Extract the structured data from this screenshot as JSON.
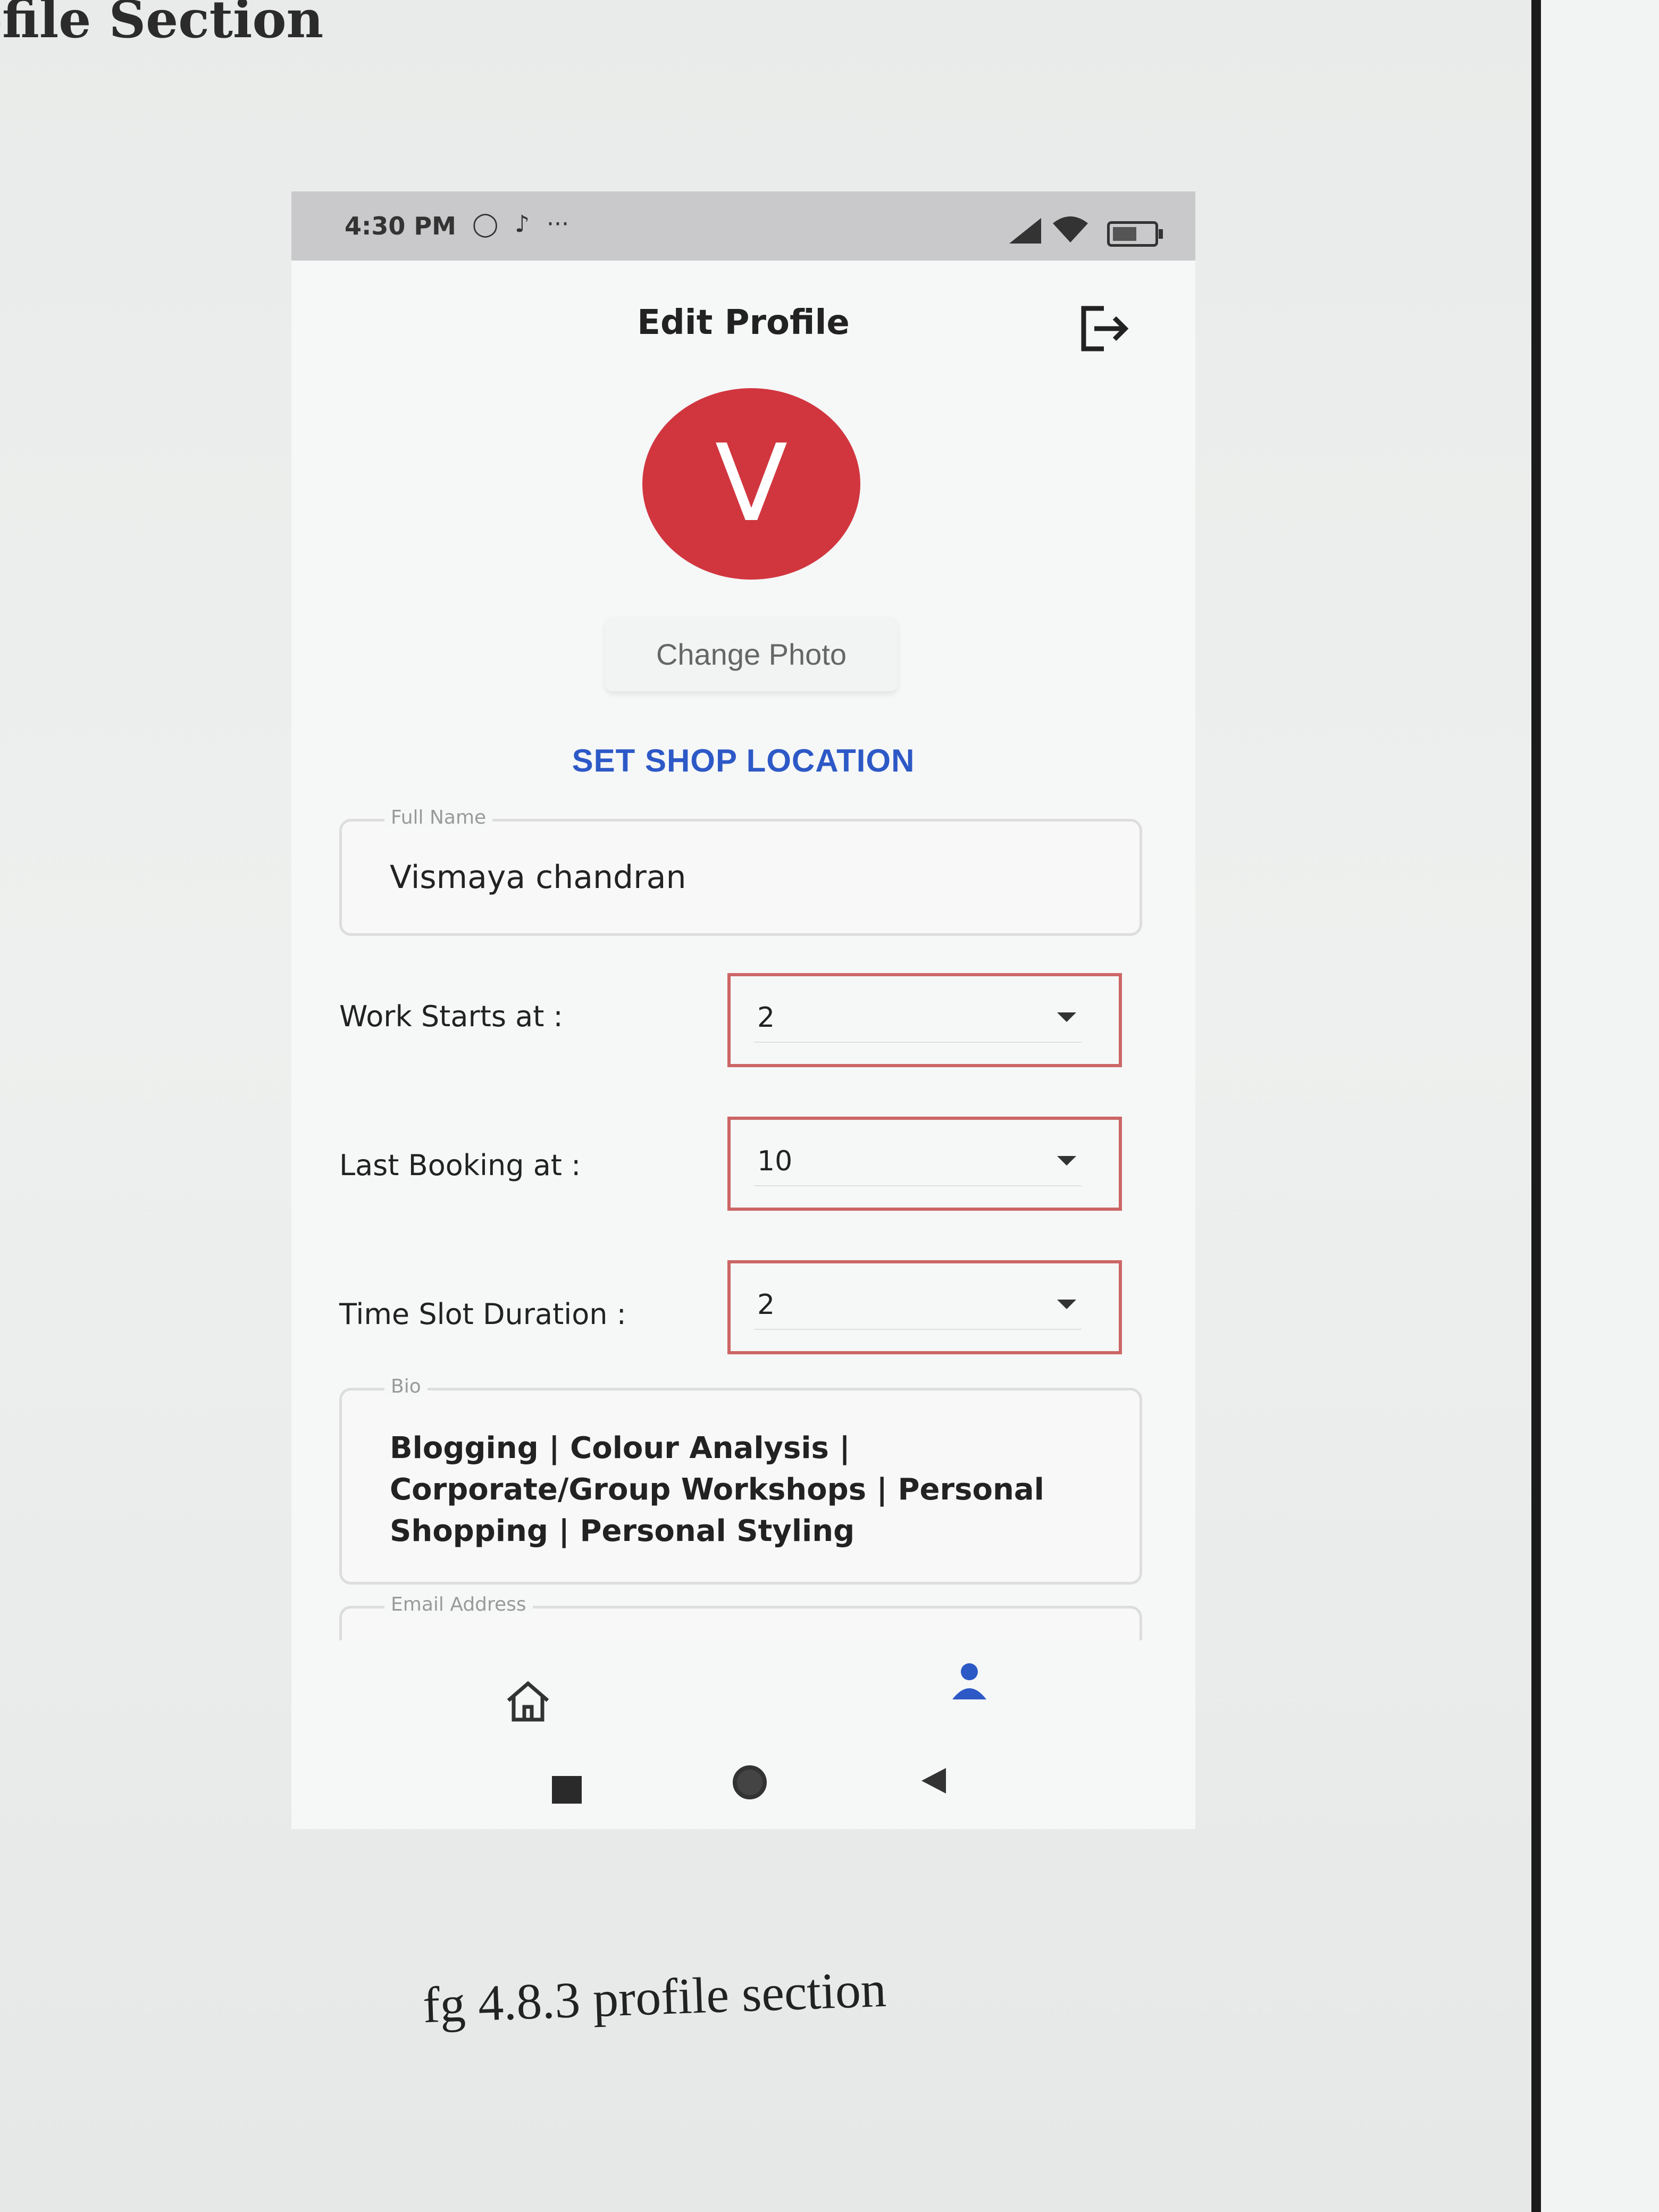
{
  "document": {
    "heading": "ofile Section",
    "caption": "fg 4.8.3 profile section"
  },
  "status_bar": {
    "time": "4:30 PM",
    "app_icons": [
      "whatsapp-icon",
      "tiktok-icon",
      "more-dots-icon"
    ],
    "right_icons": [
      "signal-icon",
      "wifi-icon",
      "battery-icon"
    ],
    "battery_level": 0.6
  },
  "header": {
    "title": "Edit Profile",
    "logout_icon": "logout-icon"
  },
  "profile": {
    "avatar_letter": "V",
    "avatar_color": "#d1363f",
    "change_photo_label": "Change Photo",
    "set_shop_location_label": "SET SHOP LOCATION"
  },
  "form": {
    "full_name": {
      "legend": "Full Name",
      "value": "Vismaya chandran"
    },
    "work_starts": {
      "label": "Work Starts at :",
      "value": "2"
    },
    "last_booking": {
      "label": "Last Booking at :",
      "value": "10"
    },
    "slot_duration": {
      "label": "Time Slot Duration :",
      "value": "2"
    },
    "bio": {
      "legend": "Bio",
      "value": "Blogging | Colour Analysis | Corporate/Group Workshops | Personal Shopping | Personal Styling"
    },
    "email": {
      "legend": "Email Address"
    }
  },
  "bottom_nav": {
    "items": [
      "home-icon",
      "profile-icon"
    ],
    "active": "profile-icon",
    "active_color": "#2d59c7"
  },
  "system_nav": [
    "recent-apps-icon",
    "home-circle-icon",
    "back-icon"
  ]
}
